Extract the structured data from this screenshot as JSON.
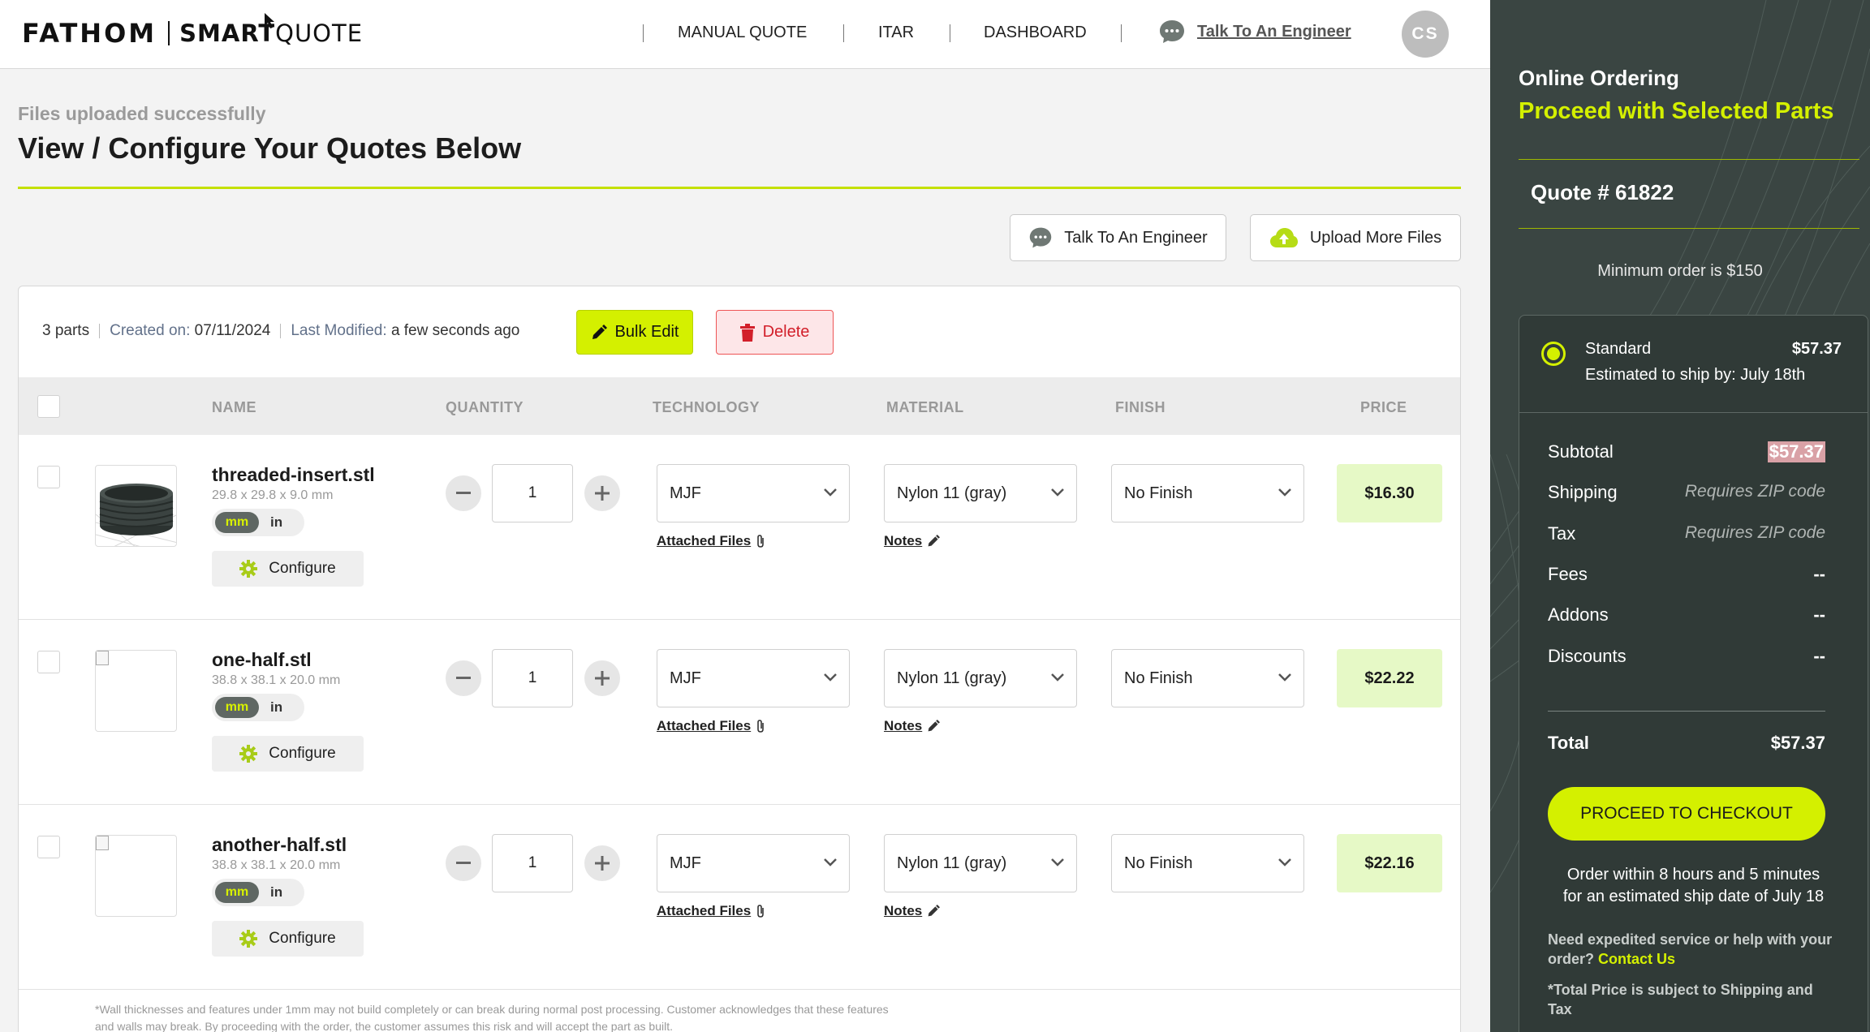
{
  "header": {
    "brand": "FATHOM",
    "product_bold": "SMART",
    "product_rest": "QUOTE",
    "nav": [
      "MANUAL QUOTE",
      "ITAR",
      "DASHBOARD"
    ],
    "talk_link": "Talk To An Engineer",
    "avatar_initials": "CS"
  },
  "page": {
    "status": "Files uploaded successfully",
    "title": "View / Configure Your Quotes Below",
    "talk_button": "Talk To An Engineer",
    "upload_button": "Upload More Files"
  },
  "card": {
    "parts_count": "3 parts",
    "created_label": "Created on:",
    "created_value": "07/11/2024",
    "modified_label": "Last Modified:",
    "modified_value": "a few seconds ago",
    "bulk_edit": "Bulk Edit",
    "delete": "Delete",
    "columns": [
      "NAME",
      "QUANTITY",
      "TECHNOLOGY",
      "MATERIAL",
      "FINISH",
      "PRICE"
    ],
    "unit_mm": "mm",
    "unit_in": "in",
    "configure": "Configure",
    "attached_files": "Attached Files",
    "notes": "Notes",
    "disclaimer": "*Wall thicknesses and features under 1mm may not build completely or can break during normal post processing. Customer acknowledges that these features and walls may break. By proceeding with the order, the customer assumes this risk and will accept the part as built."
  },
  "parts": [
    {
      "name": "threaded-insert.stl",
      "dims": "29.8 x 29.8 x 9.0 mm",
      "quantity": "1",
      "technology": "MJF",
      "material": "Nylon 11 (gray)",
      "finish": "No Finish",
      "price": "$16.30",
      "unit": "mm"
    },
    {
      "name": "one-half.stl",
      "dims": "38.8 x 38.1 x 20.0 mm",
      "quantity": "1",
      "technology": "MJF",
      "material": "Nylon 11 (gray)",
      "finish": "No Finish",
      "price": "$22.22",
      "unit": "mm"
    },
    {
      "name": "another-half.stl",
      "dims": "38.8 x 38.1 x 20.0 mm",
      "quantity": "1",
      "technology": "MJF",
      "material": "Nylon 11 (gray)",
      "finish": "No Finish",
      "price": "$22.16",
      "unit": "mm"
    }
  ],
  "panel": {
    "title": "Online Ordering",
    "subtitle": "Proceed with Selected Parts",
    "quote_number": "Quote # 61822",
    "minimum_order": "Minimum order is $150",
    "shipping_option": {
      "label": "Standard",
      "price": "$57.37",
      "estimate": "Estimated to ship by: July 18th",
      "selected": true
    },
    "summary": [
      {
        "label": "Subtotal",
        "value": "$57.37"
      },
      {
        "label": "Shipping",
        "value": "Requires ZIP code"
      },
      {
        "label": "Tax",
        "value": "Requires ZIP code"
      },
      {
        "label": "Fees",
        "value": "--"
      },
      {
        "label": "Addons",
        "value": "--"
      },
      {
        "label": "Discounts",
        "value": "--"
      }
    ],
    "total_label": "Total",
    "total_value": "$57.37",
    "checkout": "PROCEED TO CHECKOUT",
    "order_within_line1": "Order within 8 hours and 5 minutes",
    "order_within_line2": "for an estimated ship date of July 18",
    "help_text": "Need expedited service or help with your order?",
    "contact_link": "Contact Us",
    "fine_print": "*Total Price is subject to Shipping and Tax"
  },
  "colors": {
    "accent": "#d4f000",
    "panel_bg": "#3a4542",
    "delete_red": "#d21f2a",
    "price_bg": "#e6f9c6"
  }
}
